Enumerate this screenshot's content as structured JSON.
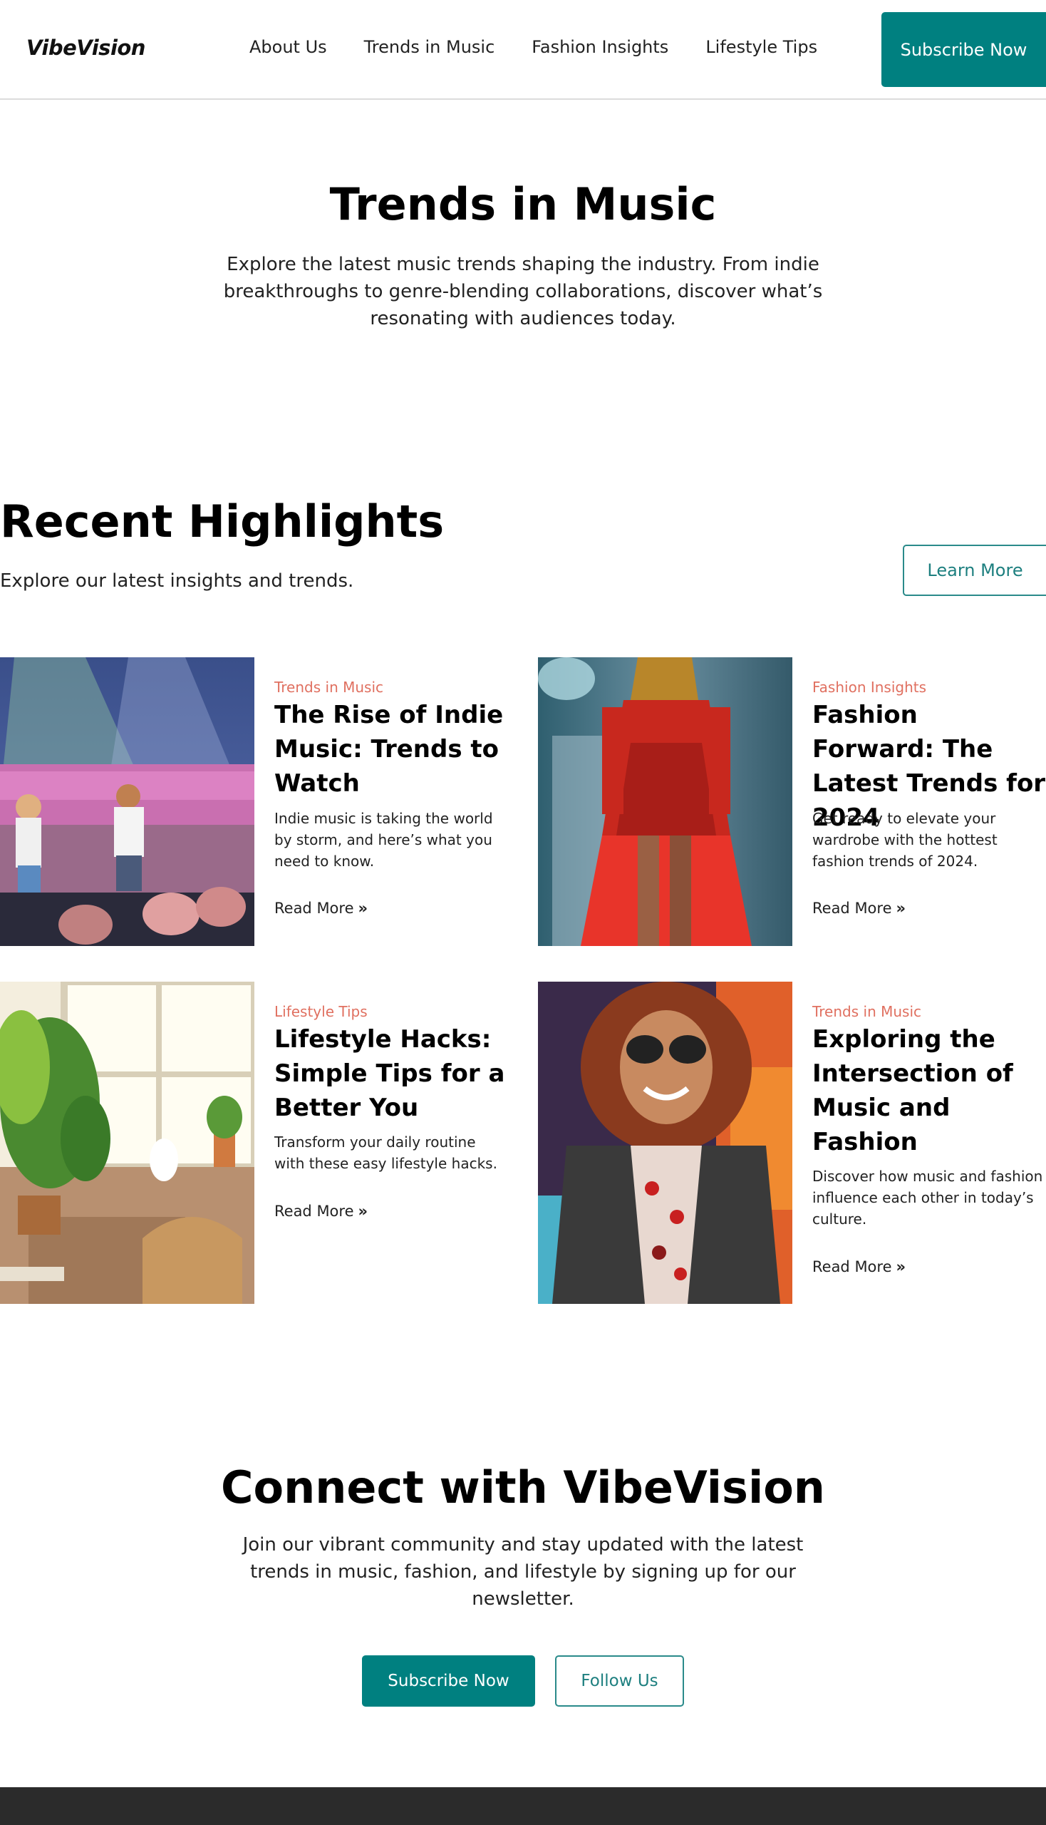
{
  "header": {
    "logo": "VibeVision",
    "nav": [
      "About Us",
      "Trends in Music",
      "Fashion Insights",
      "Lifestyle Tips"
    ],
    "subscribe_label": "Subscribe Now"
  },
  "hero": {
    "title": "Trends in Music",
    "description": "Explore the latest music trends shaping the industry. From indie breakthroughs to genre-blending collaborations, discover what’s resonating with audiences today."
  },
  "highlights": {
    "title": "Recent Highlights",
    "subtitle": "Explore our latest insights and trends.",
    "learn_more": "Learn More",
    "cards": [
      {
        "category": "Trends in Music",
        "title": "The Rise of Indie Music: Trends to Watch",
        "description": "Indie music is taking the world by storm, and here’s what you need to know.",
        "read_more": "Read More"
      },
      {
        "category": "Fashion Insights",
        "title": "Fashion Forward: The Latest Trends for 2024",
        "description": "Get ready to elevate your wardrobe with the hottest fashion trends of 2024.",
        "read_more": "Read More"
      },
      {
        "category": "Lifestyle Tips",
        "title": "Lifestyle Hacks: Simple Tips for a Better You",
        "description": "Transform your daily routine with these easy lifestyle hacks.",
        "read_more": "Read More"
      },
      {
        "category": "Trends in Music",
        "title": "Exploring the Intersection of Music and Fashion",
        "description": "Discover how music and fashion influence each other in today’s culture.",
        "read_more": "Read More"
      }
    ]
  },
  "connect": {
    "title": "Connect with VibeVision",
    "description": "Join our vibrant community and stay updated with the latest trends in music, fashion, and lifestyle by signing up for our newsletter.",
    "subscribe_label": "Subscribe Now",
    "follow_label": "Follow Us"
  },
  "colors": {
    "accent": "#008080",
    "category": "#e07060",
    "footer": "#2b2b2b"
  },
  "icons": {
    "read_more": "double-chevron-right-icon"
  }
}
